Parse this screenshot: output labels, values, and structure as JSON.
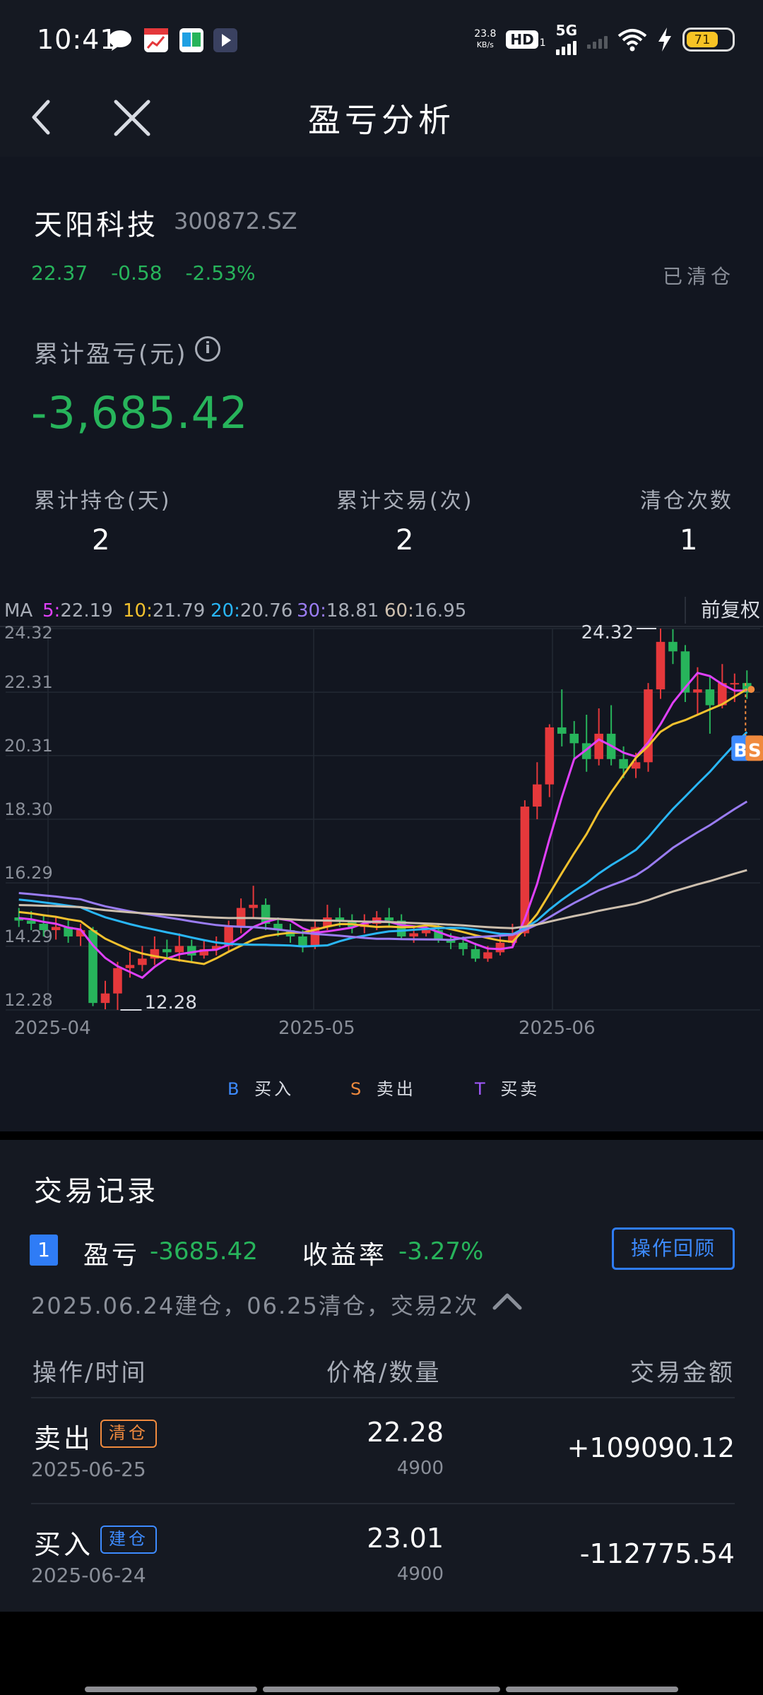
{
  "status_bar": {
    "time": "10:41",
    "net_speed_value": "23.8",
    "net_speed_unit": "KB/s",
    "hd_label": "HD",
    "hd_sub": "1",
    "network": "5G",
    "battery": "71",
    "app_icons": [
      "message-icon",
      "calendar-trend-icon",
      "book-icon",
      "play-icon"
    ],
    "icons": [
      "wifi-icon",
      "charging-bolt-icon"
    ]
  },
  "nav": {
    "title": "盈亏分析",
    "back_icon": "chevron-left-icon",
    "close_icon": "close-icon"
  },
  "stock": {
    "name": "天阳科技",
    "code": "300872.SZ",
    "price": "22.37",
    "change": "-0.58",
    "change_pct": "-2.53%",
    "position_status": "已清仓"
  },
  "summary": {
    "cum_label": "累计盈亏(元)",
    "cum_value": "-3,685.42",
    "stats": [
      {
        "label": "累计持仓(天)",
        "value": "2"
      },
      {
        "label": "累计交易(次)",
        "value": "2"
      },
      {
        "label": "清仓次数",
        "value": "1"
      }
    ]
  },
  "chart_data": {
    "type": "candlestick",
    "ma_prefix": "MA",
    "ma": [
      {
        "key": "5",
        "value": "22.19",
        "color": "#e040fb"
      },
      {
        "key": "10",
        "value": "21.79",
        "color": "#f2c12e"
      },
      {
        "key": "20",
        "value": "20.76",
        "color": "#29b6f6"
      },
      {
        "key": "30",
        "value": "18.81",
        "color": "#9a7cf2"
      },
      {
        "key": "60",
        "value": "16.95",
        "color": "#cdbfae"
      }
    ],
    "adjust_label": "前复权",
    "y_ticks": [
      "24.32",
      "22.31",
      "20.31",
      "18.30",
      "16.29",
      "14.29",
      "12.28"
    ],
    "ylim": [
      12.28,
      24.32
    ],
    "x_ticks": [
      "2025-04",
      "2025-05",
      "2025-06"
    ],
    "max_label": "24.32",
    "min_label": "12.28",
    "up_color": "#e5383b",
    "down_color": "#27b45b",
    "candles": [
      [
        15.2,
        15.1,
        15.5,
        14.9
      ],
      [
        15.1,
        15.0,
        15.4,
        14.8
      ],
      [
        15.0,
        14.8,
        15.3,
        14.6
      ],
      [
        14.8,
        14.9,
        15.2,
        14.5
      ],
      [
        14.9,
        14.6,
        15.1,
        14.4
      ],
      [
        14.6,
        14.8,
        15.0,
        14.3
      ],
      [
        14.8,
        12.5,
        14.9,
        12.4
      ],
      [
        12.5,
        12.8,
        13.2,
        12.3
      ],
      [
        12.8,
        13.6,
        13.8,
        12.28
      ],
      [
        13.6,
        13.7,
        14.1,
        13.3
      ],
      [
        13.7,
        13.9,
        14.3,
        13.5
      ],
      [
        13.9,
        14.2,
        14.6,
        13.7
      ],
      [
        14.2,
        14.1,
        14.5,
        13.9
      ],
      [
        14.1,
        14.3,
        14.7,
        13.8
      ],
      [
        14.3,
        14.0,
        14.5,
        13.8
      ],
      [
        14.0,
        14.2,
        14.5,
        13.9
      ],
      [
        14.2,
        14.3,
        14.6,
        14.0
      ],
      [
        14.3,
        14.9,
        15.1,
        14.1
      ],
      [
        14.9,
        15.5,
        15.8,
        14.7
      ],
      [
        15.5,
        15.6,
        16.2,
        15.2
      ],
      [
        15.6,
        15.0,
        15.8,
        14.8
      ],
      [
        15.0,
        14.8,
        15.2,
        14.6
      ],
      [
        14.8,
        14.6,
        15.0,
        14.4
      ],
      [
        14.6,
        14.3,
        14.8,
        14.1
      ],
      [
        14.3,
        14.9,
        15.1,
        14.2
      ],
      [
        14.9,
        15.2,
        15.6,
        14.8
      ],
      [
        15.2,
        15.1,
        15.5,
        14.9
      ],
      [
        15.1,
        14.9,
        15.3,
        14.7
      ],
      [
        14.9,
        15.0,
        15.3,
        14.7
      ],
      [
        15.0,
        15.2,
        15.4,
        14.8
      ],
      [
        15.2,
        15.1,
        15.5,
        14.9
      ],
      [
        15.1,
        14.6,
        15.3,
        14.5
      ],
      [
        14.6,
        14.7,
        14.9,
        14.4
      ],
      [
        14.7,
        14.8,
        15.0,
        14.6
      ],
      [
        14.8,
        14.5,
        15.0,
        14.4
      ],
      [
        14.5,
        14.4,
        14.7,
        14.2
      ],
      [
        14.4,
        14.2,
        14.6,
        14.0
      ],
      [
        14.2,
        13.9,
        14.4,
        13.8
      ],
      [
        13.9,
        14.1,
        14.3,
        13.8
      ],
      [
        14.1,
        14.4,
        14.6,
        14.0
      ],
      [
        14.4,
        14.7,
        15.0,
        14.3
      ],
      [
        14.7,
        18.7,
        18.9,
        14.6
      ],
      [
        18.7,
        19.4,
        20.1,
        18.3
      ],
      [
        19.4,
        21.2,
        21.3,
        19.0
      ],
      [
        21.2,
        21.0,
        22.4,
        20.6
      ],
      [
        21.0,
        20.7,
        21.4,
        20.2
      ],
      [
        20.7,
        20.2,
        21.6,
        19.8
      ],
      [
        20.2,
        21.0,
        21.8,
        20.0
      ],
      [
        21.0,
        20.2,
        21.9,
        20.0
      ],
      [
        20.2,
        19.9,
        20.6,
        19.6
      ],
      [
        19.9,
        20.1,
        20.4,
        19.6
      ],
      [
        20.1,
        22.4,
        22.6,
        19.8
      ],
      [
        22.4,
        23.9,
        24.32,
        22.1
      ],
      [
        23.9,
        23.6,
        24.3,
        23.2
      ],
      [
        23.6,
        22.3,
        23.8,
        22.0
      ],
      [
        22.3,
        22.4,
        23.1,
        21.6
      ],
      [
        22.4,
        21.9,
        22.8,
        21.0
      ],
      [
        21.9,
        22.6,
        23.2,
        21.8
      ],
      [
        22.6,
        22.6,
        22.9,
        22.0
      ],
      [
        22.6,
        22.3,
        23.0,
        22.1
      ]
    ],
    "trade_markers": [
      "B",
      "S"
    ],
    "legend": [
      {
        "symbol": "B",
        "label": "买入",
        "color": "#3d8bff"
      },
      {
        "symbol": "S",
        "label": "卖出",
        "color": "#f08a3e"
      },
      {
        "symbol": "T",
        "label": "买卖",
        "color": "#a259ff"
      }
    ]
  },
  "records": {
    "title": "交易记录",
    "index": "1",
    "pl_label": "盈亏",
    "pl_value": "-3685.42",
    "ret_label": "收益率",
    "ret_value": "-3.27%",
    "review_button": "操作回顾",
    "summary": "2025.06.24建仓，06.25清仓，交易2次",
    "columns": [
      "操作/时间",
      "价格/数量",
      "交易金额"
    ],
    "rows": [
      {
        "action": "卖出",
        "tag": "清仓",
        "tag_type": "orange",
        "date": "2025-06-25",
        "price": "22.28",
        "qty": "4900",
        "amount": "+109090.12"
      },
      {
        "action": "买入",
        "tag": "建仓",
        "tag_type": "blue",
        "date": "2025-06-24",
        "price": "23.01",
        "qty": "4900",
        "amount": "-112775.54"
      }
    ]
  }
}
